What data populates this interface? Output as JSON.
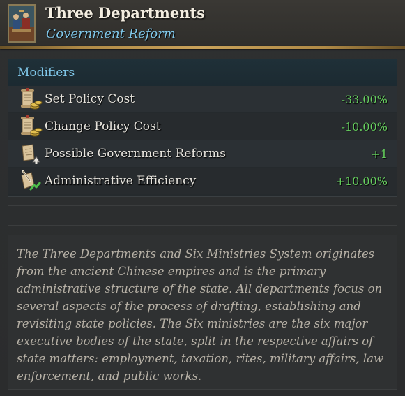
{
  "header": {
    "title": "Three Departments",
    "subtitle": "Government Reform",
    "portrait_icon": "court-scene-portrait"
  },
  "modifiers": {
    "heading": "Modifiers",
    "rows": [
      {
        "label": "Set Policy Cost",
        "value": "-33.00%",
        "icon": "policy-scroll-coins-icon"
      },
      {
        "label": "Change Policy Cost",
        "value": "-10.00%",
        "icon": "policy-scroll-coins-icon"
      },
      {
        "label": "Possible Government Reforms",
        "value": "+1",
        "icon": "reform-scroll-arrow-icon"
      },
      {
        "label": "Administrative Efficiency",
        "value": "+10.00%",
        "icon": "admin-scroll-quill-icon"
      }
    ]
  },
  "description": "The Three Departments and Six Ministries System originates from the ancient Chinese empires and is the primary administrative structure of the state. All departments focus on several aspects of the process of drafting, establishing and revisiting state policies. The Six ministries are the six major executive bodies of the state, split in the respective affairs of state matters: employment, taxation, rites, military affairs, law enforcement, and public works.",
  "colors": {
    "accent_blue": "#7fc6e8",
    "positive_green": "#66d05e",
    "gold_rule": "#c9a25a"
  }
}
